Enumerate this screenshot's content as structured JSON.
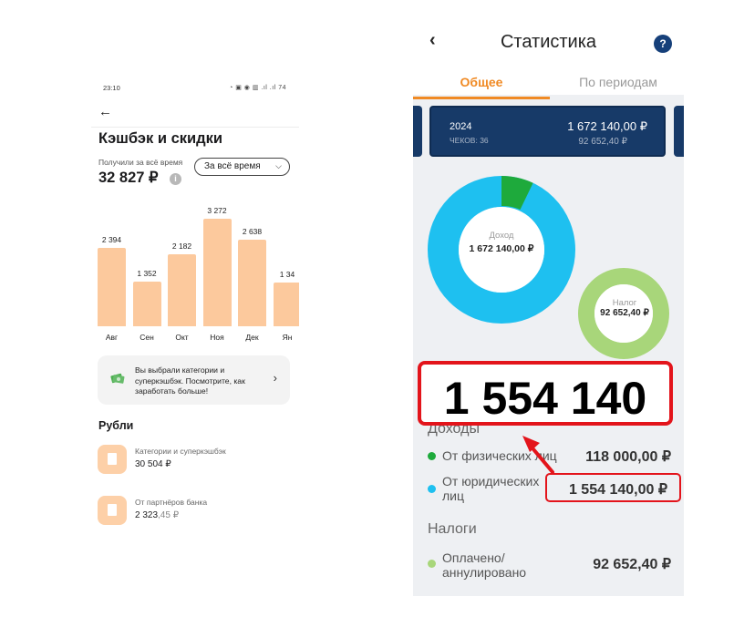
{
  "left": {
    "status_time": "23:10",
    "status_icons": "◔ ▣ ◉ ▥ .ıl .ıl 74",
    "title": "Кэшбэк и скидки",
    "received_label": "Получили за всё время",
    "total": "32 827 ₽",
    "period_select": "За всё время",
    "chart": {
      "type": "bar",
      "categories": [
        "Авг",
        "Сен",
        "Окт",
        "Ноя",
        "Дек",
        "Ян"
      ],
      "values": [
        2394,
        1352,
        2182,
        3272,
        2638,
        1340
      ],
      "value_labels": [
        "2 394",
        "1 352",
        "2 182",
        "3 272",
        "2 638",
        "1 34"
      ]
    },
    "promo_text": "Вы выбрали категории и суперкэшбэк. Посмотрите, как заработать больше!",
    "section_title": "Рубли",
    "items": [
      {
        "label": "Категории и суперкэшбэк",
        "value_main": "30 504 ₽",
        "value_dim": ""
      },
      {
        "label": "От партнёров банка",
        "value_main": "2 323",
        "value_dim": ",45 ₽"
      }
    ]
  },
  "right": {
    "title": "Статистика",
    "help": "?",
    "tabs": [
      {
        "label": "Общее",
        "active": true
      },
      {
        "label": "По периодам",
        "active": false
      }
    ],
    "card": {
      "year": "2024",
      "checks": "ЧЕКОВ: 36",
      "amount": "1 672 140,00 ₽",
      "tax": "92 652,40 ₽"
    },
    "donut_income": {
      "label": "Доход",
      "value": "1 672 140,00 ₽",
      "share_small": 0.07
    },
    "donut_tax": {
      "label": "Налог",
      "value": "92 652,40 ₽"
    },
    "income_section": "Доходы",
    "income_rows": [
      {
        "label": "От физических лиц",
        "value": "118 000,00 ₽",
        "color": "#1eaa3c"
      },
      {
        "label": "От юридических лиц",
        "value": "1 554 140,00 ₽",
        "color": "#1ec0f0"
      }
    ],
    "tax_section": "Налоги",
    "tax_rows": [
      {
        "label": "Оплачено/ аннулировано",
        "value": "92 652,40 ₽",
        "color": "#a8d67a"
      }
    ]
  },
  "annotation": {
    "big_number": "1 554 140"
  },
  "colors": {
    "bar": "#fcc99d",
    "accent_orange": "#f08a24",
    "card_navy": "#173a68",
    "donut_blue": "#1ec0f0",
    "donut_green": "#1eaa3c",
    "tax_green": "#a8d67a",
    "annotation_red": "#e3141b"
  }
}
